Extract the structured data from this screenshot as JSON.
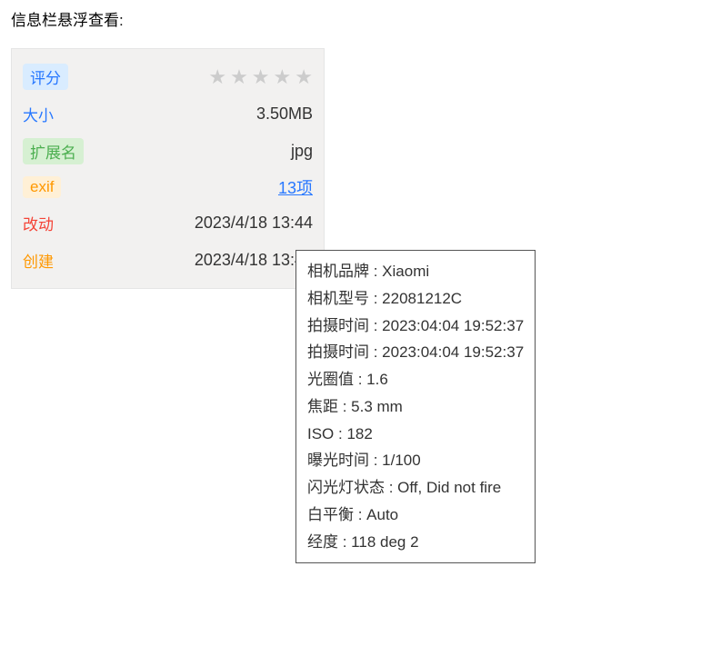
{
  "heading": "信息栏悬浮查看:",
  "panel": {
    "rating_label": "评分",
    "size_label": "大小",
    "size_value": "3.50MB",
    "ext_label": "扩展名",
    "ext_value": "jpg",
    "exif_label": "exif",
    "exif_value": "13项",
    "modified_label": "改动",
    "modified_value": "2023/4/18 13:44",
    "created_label": "创建",
    "created_value": "2023/4/18 13:44"
  },
  "tooltip": {
    "lines": [
      "相机品牌 : Xiaomi",
      "相机型号 : 22081212C",
      "拍摄时间 : 2023:04:04 19:52:37",
      "拍摄时间 : 2023:04:04 19:52:37",
      "光圈值 : 1.6",
      "焦距 : 5.3 mm",
      "ISO : 182",
      "曝光时间 : 1/100",
      "闪光灯状态 : Off, Did not fire",
      "白平衡 : Auto",
      "经度 : 118 deg 2"
    ]
  }
}
